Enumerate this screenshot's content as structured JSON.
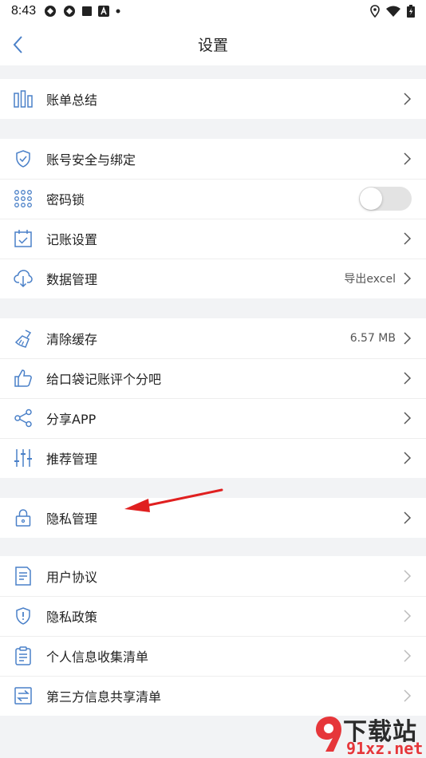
{
  "status_bar": {
    "time": "8:43"
  },
  "header": {
    "title": "设置"
  },
  "groups": [
    {
      "items": [
        {
          "label": "账单总结"
        }
      ]
    },
    {
      "items": [
        {
          "label": "账号安全与绑定"
        },
        {
          "label": "密码锁",
          "toggle_on": false
        },
        {
          "label": "记账设置"
        },
        {
          "label": "数据管理",
          "value": "导出excel"
        }
      ]
    },
    {
      "items": [
        {
          "label": "清除缓存",
          "value": "6.57 MB"
        },
        {
          "label": "给口袋记账评个分吧"
        },
        {
          "label": "分享APP"
        },
        {
          "label": "推荐管理"
        }
      ]
    },
    {
      "items": [
        {
          "label": "隐私管理"
        }
      ]
    },
    {
      "items": [
        {
          "label": "用户协议"
        },
        {
          "label": "隐私政策"
        },
        {
          "label": "个人信息收集清单"
        },
        {
          "label": "第三方信息共享清单"
        }
      ]
    }
  ],
  "watermark": {
    "title": "下载站",
    "url": "91xz.net"
  },
  "colors": {
    "icon_blue": "#4a80c8",
    "chevron": "#555555",
    "chevron_light": "#bbbbbb",
    "arrow_red": "#e02020",
    "background": "#f2f3f5"
  }
}
